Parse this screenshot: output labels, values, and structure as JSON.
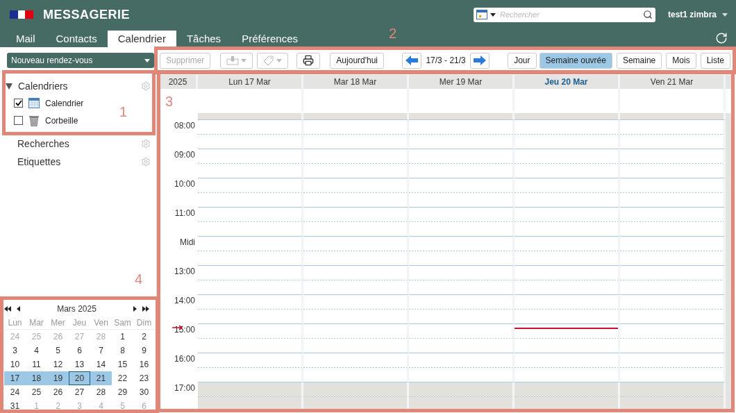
{
  "header": {
    "title": "MESSAGERIE",
    "search": {
      "placeholder": "Rechercher"
    },
    "user": "test1 zimbra"
  },
  "tabs": [
    {
      "label": "Mail",
      "selected": false
    },
    {
      "label": "Contacts",
      "selected": false
    },
    {
      "label": "Calendrier",
      "selected": true
    },
    {
      "label": "Tâches",
      "selected": false
    },
    {
      "label": "Préférences",
      "selected": false
    }
  ],
  "new_button": "Nouveau rendez-vous",
  "folders": {
    "label": "Calendriers",
    "expanded": true,
    "items": [
      {
        "label": "Calendrier",
        "checked": true,
        "kind": "calendar"
      },
      {
        "label": "Corbeille",
        "checked": false,
        "kind": "trash"
      }
    ]
  },
  "sections": [
    "Recherches",
    "Etiquettes"
  ],
  "toolbar": {
    "actions": [
      {
        "kind": "text",
        "label": "Supprimer",
        "disabled": true
      },
      {
        "kind": "move",
        "disabled": true
      },
      {
        "kind": "tag",
        "disabled": true
      },
      {
        "kind": "print",
        "disabled": false
      },
      {
        "kind": "text",
        "label": "Aujourd'hui",
        "disabled": false
      }
    ],
    "range": "17/3 - 21/3",
    "views": [
      {
        "label": "Jour",
        "selected": false
      },
      {
        "label": "Semaine ouvrée",
        "selected": true
      },
      {
        "label": "Semaine",
        "selected": false
      },
      {
        "label": "Mois",
        "selected": false
      },
      {
        "label": "Liste",
        "selected": false
      }
    ]
  },
  "calendar": {
    "year": "2025",
    "days": [
      {
        "label": "Lun 17 Mar",
        "today": false
      },
      {
        "label": "Mar 18 Mar",
        "today": false
      },
      {
        "label": "Mer 19 Mar",
        "today": false
      },
      {
        "label": "Jeu 20 Mar",
        "today": true
      },
      {
        "label": "Ven 21 Mar",
        "today": false
      }
    ],
    "hours": [
      {
        "label": "08:00",
        "off": false,
        "now": false
      },
      {
        "label": "09:00",
        "off": false,
        "now": false
      },
      {
        "label": "10:00",
        "off": false,
        "now": false
      },
      {
        "label": "11:00",
        "off": false,
        "now": false
      },
      {
        "label": "Midi",
        "off": false,
        "now": false
      },
      {
        "label": "13:00",
        "off": false,
        "now": false
      },
      {
        "label": "14:00",
        "off": false,
        "now": false
      },
      {
        "label": "15:00",
        "off": false,
        "now": true
      },
      {
        "label": "16:00",
        "off": false,
        "now": false
      },
      {
        "label": "17:00",
        "off": true,
        "now": false
      }
    ]
  },
  "mini_calendar": {
    "title": "Mars 2025",
    "weekdays": [
      "Lun",
      "Mar",
      "Mer",
      "Jeu",
      "Ven",
      "Sam",
      "Dim"
    ],
    "weeks": [
      [
        {
          "label": "24",
          "other_month": true,
          "selected": false,
          "today": false
        },
        {
          "label": "25",
          "other_month": true,
          "selected": false,
          "today": false
        },
        {
          "label": "26",
          "other_month": true,
          "selected": false,
          "today": false
        },
        {
          "label": "27",
          "other_month": true,
          "selected": false,
          "today": false
        },
        {
          "label": "28",
          "other_month": true,
          "selected": false,
          "today": false
        },
        {
          "label": "1",
          "other_month": false,
          "selected": false,
          "today": false
        },
        {
          "label": "2",
          "other_month": false,
          "selected": false,
          "today": false
        }
      ],
      [
        {
          "label": "3",
          "other_month": false,
          "selected": false,
          "today": false
        },
        {
          "label": "4",
          "other_month": false,
          "selected": false,
          "today": false
        },
        {
          "label": "5",
          "other_month": false,
          "selected": false,
          "today": false
        },
        {
          "label": "6",
          "other_month": false,
          "selected": false,
          "today": false
        },
        {
          "label": "7",
          "other_month": false,
          "selected": false,
          "today": false
        },
        {
          "label": "8",
          "other_month": false,
          "selected": false,
          "today": false
        },
        {
          "label": "9",
          "other_month": false,
          "selected": false,
          "today": false
        }
      ],
      [
        {
          "label": "10",
          "other_month": false,
          "selected": false,
          "today": false
        },
        {
          "label": "11",
          "other_month": false,
          "selected": false,
          "today": false
        },
        {
          "label": "12",
          "other_month": false,
          "selected": false,
          "today": false
        },
        {
          "label": "13",
          "other_month": false,
          "selected": false,
          "today": false
        },
        {
          "label": "14",
          "other_month": false,
          "selected": false,
          "today": false
        },
        {
          "label": "15",
          "other_month": false,
          "selected": false,
          "today": false
        },
        {
          "label": "16",
          "other_month": false,
          "selected": false,
          "today": false
        }
      ],
      [
        {
          "label": "17",
          "other_month": false,
          "selected": true,
          "today": false
        },
        {
          "label": "18",
          "other_month": false,
          "selected": true,
          "today": false
        },
        {
          "label": "19",
          "other_month": false,
          "selected": true,
          "today": false
        },
        {
          "label": "20",
          "other_month": false,
          "selected": true,
          "today": true
        },
        {
          "label": "21",
          "other_month": false,
          "selected": true,
          "today": false
        },
        {
          "label": "22",
          "other_month": false,
          "selected": false,
          "today": false
        },
        {
          "label": "23",
          "other_month": false,
          "selected": false,
          "today": false
        }
      ],
      [
        {
          "label": "24",
          "other_month": false,
          "selected": false,
          "today": false
        },
        {
          "label": "25",
          "other_month": false,
          "selected": false,
          "today": false
        },
        {
          "label": "26",
          "other_month": false,
          "selected": false,
          "today": false
        },
        {
          "label": "27",
          "other_month": false,
          "selected": false,
          "today": false
        },
        {
          "label": "28",
          "other_month": false,
          "selected": false,
          "today": false
        },
        {
          "label": "29",
          "other_month": false,
          "selected": false,
          "today": false
        },
        {
          "label": "30",
          "other_month": false,
          "selected": false,
          "today": false
        }
      ],
      [
        {
          "label": "31",
          "other_month": false,
          "selected": false,
          "today": false
        },
        {
          "label": "1",
          "other_month": true,
          "selected": false,
          "today": false
        },
        {
          "label": "2",
          "other_month": true,
          "selected": false,
          "today": false
        },
        {
          "label": "3",
          "other_month": true,
          "selected": false,
          "today": false
        },
        {
          "label": "4",
          "other_month": true,
          "selected": false,
          "today": false
        },
        {
          "label": "5",
          "other_month": true,
          "selected": false,
          "today": false
        },
        {
          "label": "6",
          "other_month": true,
          "selected": false,
          "today": false
        }
      ]
    ]
  },
  "annotations": [
    {
      "label": "1"
    },
    {
      "label": "2"
    },
    {
      "label": "3"
    },
    {
      "label": "4"
    }
  ]
}
